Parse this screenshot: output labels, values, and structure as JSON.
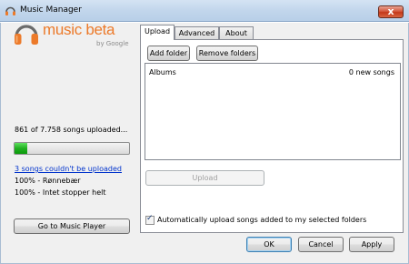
{
  "window": {
    "title": "Music Manager",
    "close_glyph": "x"
  },
  "logo": {
    "name": "music beta",
    "byline": "by Google",
    "icon": "headphones-icon",
    "accent": "#ec7a2a"
  },
  "status": {
    "upload_count": "861 of 7.758 songs uploaded...",
    "progress_fraction": 0.11,
    "error_link": "3 songs couldn't be uploaded",
    "songs": [
      "100% - Rønnebær",
      "100% - Intet stopper helt"
    ]
  },
  "left_button": "Go to Music Player",
  "tabs": [
    {
      "label": "Upload",
      "active": true
    },
    {
      "label": "Advanced",
      "active": false
    },
    {
      "label": "About",
      "active": false
    }
  ],
  "upload_panel": {
    "add_folder": "Add folder",
    "remove_folders": "Remove folders",
    "list": {
      "column_left": "Albums",
      "column_right": "0 new songs"
    },
    "upload_button": "Upload",
    "auto_upload": {
      "checked": true,
      "label": "Automatically upload songs added to my selected folders"
    }
  },
  "dialog_buttons": {
    "ok": "OK",
    "cancel": "Cancel",
    "apply": "Apply"
  }
}
